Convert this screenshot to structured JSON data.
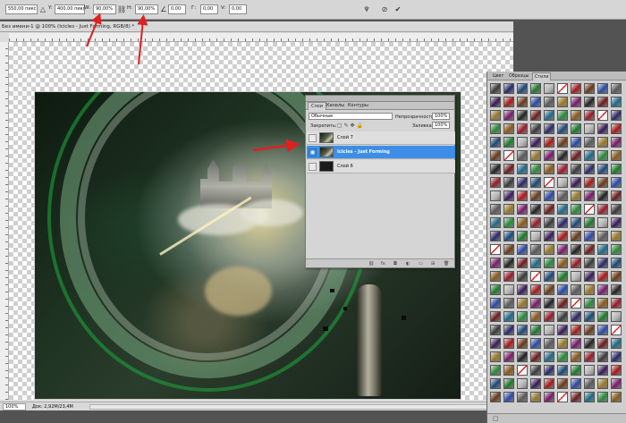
{
  "options_bar": {
    "x_value": "550,00 пикс",
    "y_label": "Y:",
    "y_value": "400,00 пикс",
    "w_label": "W:",
    "w_value": "90,00%",
    "h_label": "H:",
    "h_value": "90,00%",
    "rotate_value": "0,00",
    "h_skew_label": "Г:",
    "h_skew_value": "0,00",
    "v_skew_label": "V:",
    "v_skew_value": "0,00"
  },
  "document": {
    "title": "Без имени-1 @ 100% (Icicles - Just Forming, RGB/8) *",
    "zoom": "100%",
    "doc_size": "Док: 2,92M/23,4M"
  },
  "layers_panel": {
    "tabs": [
      "Слои",
      "Каналы",
      "Контуры"
    ],
    "active_tab": "Слои",
    "blend_mode": "Обычные",
    "opacity_label": "Непрозрачность:",
    "opacity_value": "100%",
    "lock_label": "Закрепить:",
    "fill_label": "Заливка:",
    "fill_value": "100%",
    "layers": [
      {
        "name": "Слой 7",
        "visible": false,
        "selected": false
      },
      {
        "name": "Icicles - Just Forming",
        "visible": true,
        "selected": true
      },
      {
        "name": "Слой 6",
        "visible": false,
        "selected": false
      }
    ]
  },
  "styles_panel": {
    "tabs": [
      "Цвет",
      "Образцы",
      "Стили"
    ],
    "active_tab": "Стили",
    "swatch_colors": [
      "#3a3a3a",
      "#6e1c1c",
      "#2a4aa8",
      "#1d7a2a",
      "#8a5a1a",
      "#7a1a6a",
      "#a81a1a",
      "#2a2a6a",
      "#1e6a8a",
      "#5a5a5a",
      "#b8b8b8",
      "#9a1a2a",
      "#222222",
      "#6a3a1a",
      "#1a4a7a",
      "#2a8a3a",
      "#9a7a2a",
      "#3a1a5a"
    ],
    "selected_color": "#ffffff",
    "accent_red": "#e02020",
    "blue_accent": "#3d8ee6"
  }
}
